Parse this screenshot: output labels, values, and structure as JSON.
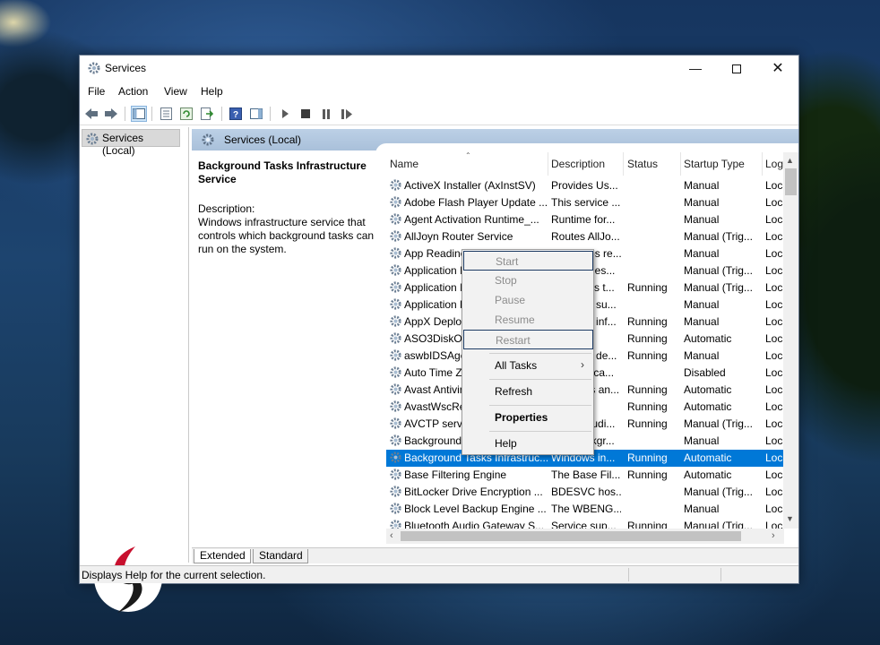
{
  "window": {
    "title": "Services"
  },
  "menu": [
    "File",
    "Action",
    "View",
    "Help"
  ],
  "tree": {
    "item": "Services (Local)"
  },
  "content_header": "Services (Local)",
  "details": {
    "service_name": "Background Tasks Infrastructure Service",
    "description_label": "Description:",
    "description": "Windows infrastructure service that controls which background tasks can run on the system."
  },
  "columns": [
    "Name",
    "Description",
    "Status",
    "Startup Type",
    "Log"
  ],
  "rows": [
    {
      "name": "ActiveX Installer (AxInstSV)",
      "desc": "Provides Us...",
      "status": "",
      "startup": "Manual",
      "log": "Loca"
    },
    {
      "name": "Adobe Flash Player Update ...",
      "desc": "This service ...",
      "status": "",
      "startup": "Manual",
      "log": "Loca"
    },
    {
      "name": "Agent Activation Runtime_...",
      "desc": "Runtime for...",
      "status": "",
      "startup": "Manual",
      "log": "Loca"
    },
    {
      "name": "AllJoyn Router Service",
      "desc": "Routes AllJo...",
      "status": "",
      "startup": "Manual (Trig...",
      "log": "Loca"
    },
    {
      "name": "App Readine",
      "desc": "Gets apps re...",
      "status": "",
      "startup": "Manual",
      "log": "Loca"
    },
    {
      "name": "Application I",
      "desc": "Determines...",
      "status": "",
      "startup": "Manual (Trig...",
      "log": "Loca"
    },
    {
      "name": "Application I",
      "desc": "Facilitates t...",
      "status": "Running",
      "startup": "Manual (Trig...",
      "log": "Loca"
    },
    {
      "name": "Application L",
      "desc": "Provides su...",
      "status": "",
      "startup": "Manual",
      "log": "Loca"
    },
    {
      "name": "AppX Deploy",
      "desc": "Provides inf...",
      "status": "Running",
      "startup": "Manual",
      "log": "Loca"
    },
    {
      "name": "ASO3DiskOp",
      "desc": "",
      "status": "Running",
      "startup": "Automatic",
      "log": "Loca"
    },
    {
      "name": "aswbIDSAger",
      "desc": "Provides de...",
      "status": "Running",
      "startup": "Manual",
      "log": "Loca"
    },
    {
      "name": "Auto Time Zo",
      "desc": "Automatica...",
      "status": "",
      "startup": "Disabled",
      "log": "Loca"
    },
    {
      "name": "Avast Antivir",
      "desc": "Manages an...",
      "status": "Running",
      "startup": "Automatic",
      "log": "Loca"
    },
    {
      "name": "AvastWscRep",
      "desc": "",
      "status": "Running",
      "startup": "Automatic",
      "log": "Loca"
    },
    {
      "name": "AVCTP servic",
      "desc": "This is Audi...",
      "status": "Running",
      "startup": "Manual (Trig...",
      "log": "Loca"
    },
    {
      "name": "Background",
      "desc": "The Backgr...",
      "status": "",
      "startup": "Manual",
      "log": "Loca"
    },
    {
      "name": "Background Tasks Infrastruc...",
      "desc": "Windows in...",
      "status": "Running",
      "startup": "Automatic",
      "log": "Loca"
    },
    {
      "name": "Base Filtering Engine",
      "desc": "The Base Fil...",
      "status": "Running",
      "startup": "Automatic",
      "log": "Loca"
    },
    {
      "name": "BitLocker Drive Encryption ...",
      "desc": "BDESVC hos...",
      "status": "",
      "startup": "Manual (Trig...",
      "log": "Loca"
    },
    {
      "name": "Block Level Backup Engine ...",
      "desc": "The WBENG...",
      "status": "",
      "startup": "Manual",
      "log": "Loca"
    },
    {
      "name": "Bluetooth Audio Gateway S...",
      "desc": "Service sup...",
      "status": "Running",
      "startup": "Manual (Trig...",
      "log": "Loca"
    }
  ],
  "context_menu": {
    "start": "Start",
    "stop": "Stop",
    "pause": "Pause",
    "resume": "Resume",
    "restart": "Restart",
    "all_tasks": "All Tasks",
    "refresh": "Refresh",
    "properties": "Properties",
    "help": "Help"
  },
  "tabs": [
    "Extended",
    "Standard"
  ],
  "status_bar": "Displays Help for the current selection.",
  "colors": {
    "selection": "#0078d7",
    "header_band": "#bcd0e6",
    "logo_red": "#c8102e"
  },
  "icons": [
    "services-gear-icon",
    "back-arrow-icon",
    "forward-arrow-icon",
    "play-icon",
    "stop-icon",
    "pause-icon",
    "restart-icon",
    "help-icon"
  ]
}
